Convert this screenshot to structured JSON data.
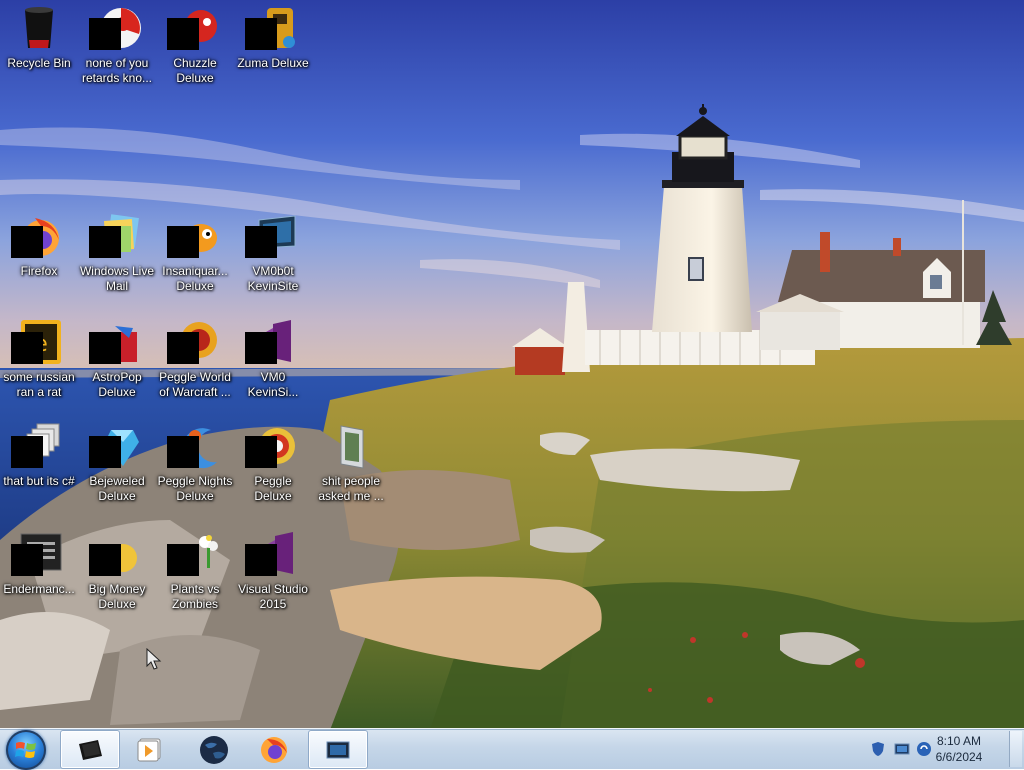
{
  "desktop": {
    "icons": [
      {
        "label": "Recycle Bin"
      },
      {
        "label": "none of you\nretards kno..."
      },
      {
        "label": "Chuzzle\nDeluxe"
      },
      {
        "label": "Zuma Deluxe"
      },
      {
        "label": "Firefox"
      },
      {
        "label": "Windows Live\nMail"
      },
      {
        "label": "Insaniquar...\nDeluxe"
      },
      {
        "label": "VM0b0t\nKevinSite"
      },
      {
        "label": "some russian\nran a rat"
      },
      {
        "label": "AstroPop\nDeluxe"
      },
      {
        "label": "Peggle World\nof Warcraft ..."
      },
      {
        "label": "VM0\nKevinSi..."
      },
      {
        "label": "that but its c#"
      },
      {
        "label": "Bejeweled\nDeluxe"
      },
      {
        "label": "Peggle Nights\nDeluxe"
      },
      {
        "label": "Peggle Deluxe"
      },
      {
        "label": "shit people\nasked me ..."
      },
      {
        "label": "Endermanc..."
      },
      {
        "label": "Big Money\nDeluxe"
      },
      {
        "label": "Plants vs\nZombies"
      },
      {
        "label": "Visual Studio\n2015"
      }
    ]
  },
  "taskbar": {
    "pinned": [
      "tablet-app-icon",
      "media-player-icon",
      "globe-icon",
      "firefox-icon",
      "monitor-app-icon"
    ],
    "tray_icons": [
      "shield-icon",
      "network-icon",
      "update-icon"
    ],
    "clock": {
      "time": "8:10 AM",
      "date": "6/6/2024"
    }
  },
  "colors": {
    "taskbar": "#c5d6e8",
    "sky": "#3a56b8",
    "label_text": "#ffffff"
  }
}
